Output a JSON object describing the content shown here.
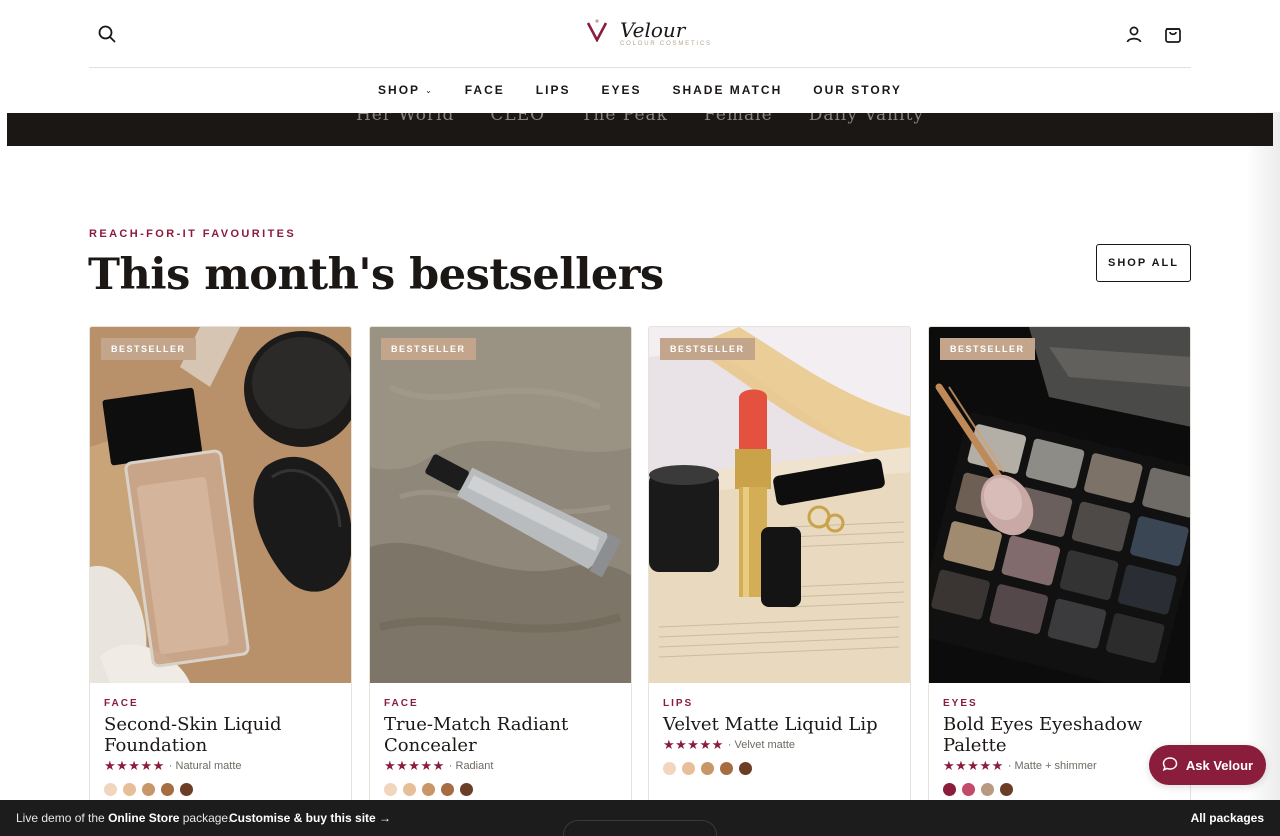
{
  "brand": {
    "name": "Velour",
    "tagline": "COLOUR COSMETICS",
    "accent": "#8a1c3c"
  },
  "header": {
    "icons": [
      "search-icon",
      "account-icon",
      "cart-icon"
    ]
  },
  "nav": [
    {
      "label": "SHOP",
      "has_dropdown": true
    },
    {
      "label": "FACE"
    },
    {
      "label": "LIPS"
    },
    {
      "label": "EYES"
    },
    {
      "label": "SHADE MATCH"
    },
    {
      "label": "OUR STORY"
    }
  ],
  "press": [
    "Her World",
    "CLEO",
    "The Peak",
    "Female",
    "Daily Vanity"
  ],
  "section": {
    "eyebrow": "REACH-FOR-IT FAVOURITES",
    "title": "This month's bestsellers",
    "shop_all": "SHOP ALL"
  },
  "products": [
    {
      "badge": "BESTSELLER",
      "category": "FACE",
      "name": "Second-Skin Liquid Foundation",
      "stars": "★★★★★",
      "finish": "· Natural matte",
      "swatches": [
        "#f1d6bd",
        "#e6bf98",
        "#c99667",
        "#a66d42",
        "#6b3d24"
      ]
    },
    {
      "badge": "BESTSELLER",
      "category": "FACE",
      "name": "True-Match Radiant Concealer",
      "stars": "★★★★★",
      "finish": "· Radiant",
      "swatches": [
        "#f1d6bd",
        "#e6bf98",
        "#c99667",
        "#a66d42",
        "#6b3d24"
      ]
    },
    {
      "badge": "BESTSELLER",
      "category": "LIPS",
      "name": "Velvet Matte Liquid Lip",
      "stars": "★★★★★",
      "finish": "· Velvet matte",
      "swatches": [
        "#f1d6bd",
        "#e6bf98",
        "#c99667",
        "#a66d42",
        "#6b3d24"
      ]
    },
    {
      "badge": "BESTSELLER",
      "category": "EYES",
      "name": "Bold Eyes Eyeshadow Palette",
      "stars": "★★★★★",
      "finish": "· Matte + shimmer",
      "swatches": [
        "#8a1c3c",
        "#c44a6a",
        "#b89a82",
        "#6b3d24"
      ]
    }
  ],
  "ask": {
    "label": "Ask Velour"
  },
  "bottom_bar": {
    "prefix": "Live demo of the ",
    "package": "Online Store",
    "suffix": " package.",
    "cta": "Customise & buy this site →",
    "right": "All packages"
  }
}
